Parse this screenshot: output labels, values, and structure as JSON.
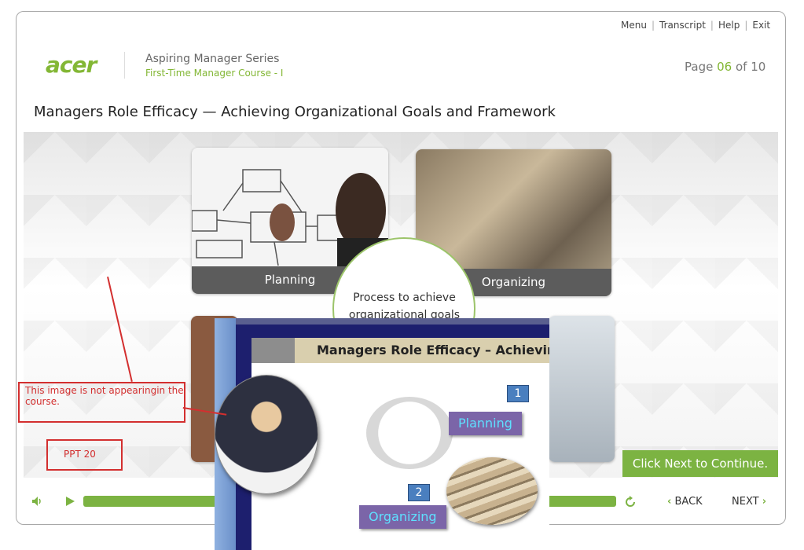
{
  "topnav": {
    "menu": "Menu",
    "transcript": "Transcript",
    "help": "Help",
    "exit": "Exit"
  },
  "header": {
    "logo_text": "acer",
    "series": "Aspiring Manager Series",
    "course": "First-Time Manager Course - I",
    "page_prefix": "Page",
    "page_current": "06",
    "page_of": "of 10"
  },
  "slide": {
    "title": "Managers Role Efficacy — Achieving Organizational Goals and Framework",
    "tiles": [
      {
        "caption": "Planning"
      },
      {
        "caption": "Organizing"
      }
    ],
    "center_text": "Process to achieve organizational goals",
    "click_next": "Click Next to Continue."
  },
  "overlay": {
    "title": "Managers Role Efficacy – Achieving O",
    "items": [
      {
        "num": "1",
        "label": "Planning"
      },
      {
        "num": "2",
        "label": "Organizing"
      }
    ]
  },
  "annotations": {
    "note": "This image is not appearingin the course.",
    "ppt": "PPT 20",
    "color": "#d32f2f"
  },
  "controls": {
    "back": "BACK",
    "next": "NEXT",
    "progress_percent": 100
  },
  "colors": {
    "accent": "#7cb342",
    "brand": "#83b735"
  }
}
